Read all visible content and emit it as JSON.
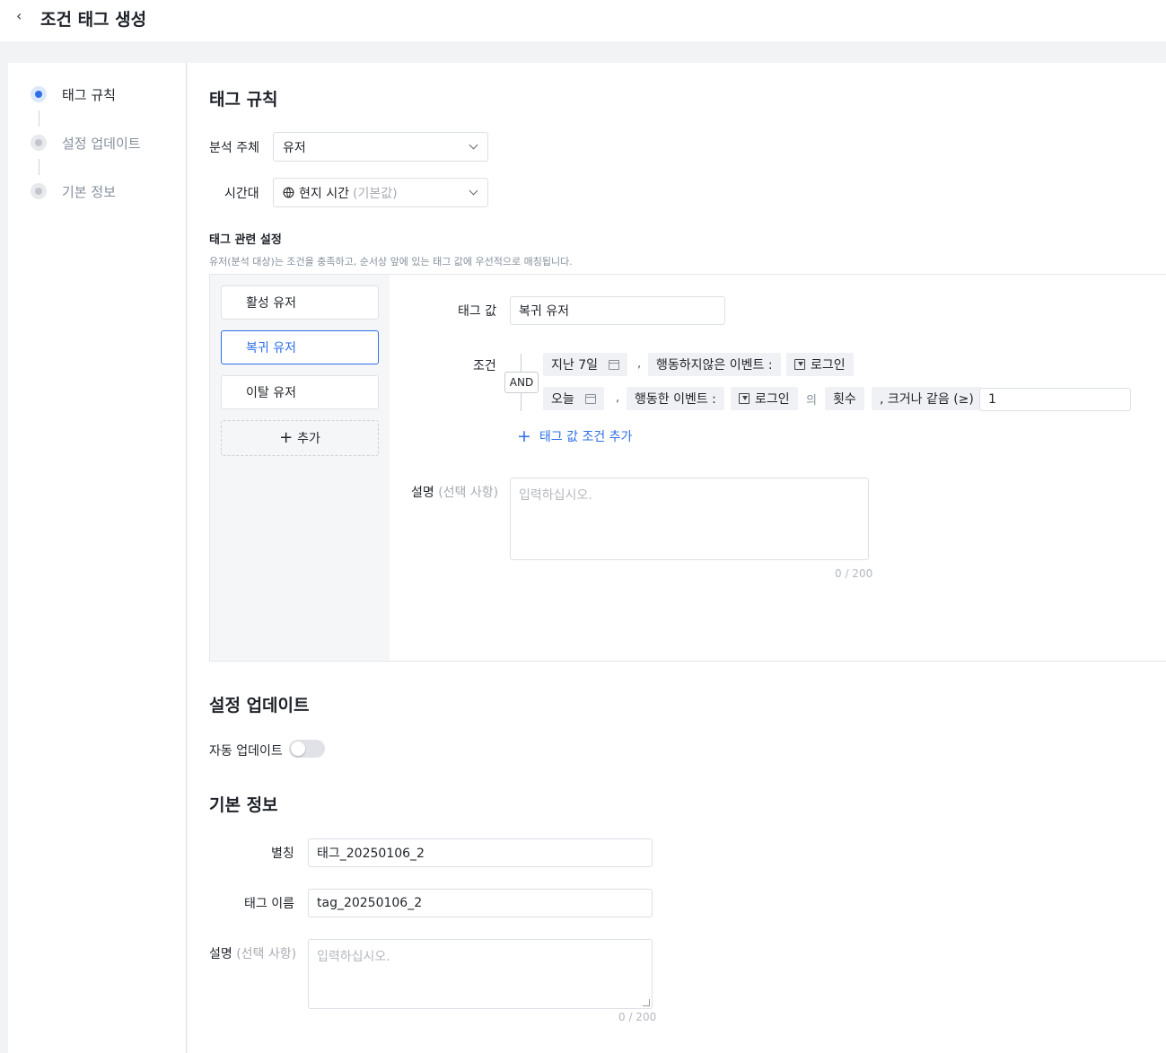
{
  "header": {
    "back_icon": "chevron-left-icon",
    "title": "조건 태그 생성"
  },
  "steps": [
    {
      "label": "태그 규칙",
      "active": true
    },
    {
      "label": "설정 업데이트",
      "active": false
    },
    {
      "label": "기본 정보",
      "active": false
    }
  ],
  "tag_rule": {
    "title": "태그 규칙",
    "subject_label": "분석 주체",
    "subject_value": "유저",
    "timezone_label": "시간대",
    "timezone_value": "현지 시간",
    "timezone_hint": "(기본값)",
    "settings_title": "태그 관련 설정",
    "settings_desc": "유저(분석 대상)는 조건을 충족하고, 순서상 앞에 있는 태그 값에 우선적으로 매칭됩니다.",
    "tag_values": [
      "활성 유저",
      "복귀 유저",
      "이탈 유저"
    ],
    "add_label": "추가",
    "tag_value_label": "태그 값",
    "tag_value_input": "복귀 유저",
    "condition_label": "조건",
    "and_label": "AND",
    "cond1": {
      "date": "지난 7일",
      "comma": ",",
      "event_type": "행동하지않은 이벤트 :",
      "event": "로그인"
    },
    "cond2": {
      "date": "오늘",
      "comma": ",",
      "event_type": "행동한 이벤트 :",
      "event": "로그인",
      "of": "의",
      "metric": "횟수",
      "operator": ", 크거나 같음 (≥)",
      "value": "1"
    },
    "add_condition": "태그 값 조건 추가",
    "desc_label": "설명",
    "desc_optional": "(선택 사항)",
    "desc_placeholder": "입력하십시오.",
    "desc_counter": "0 / 200"
  },
  "update": {
    "title": "설정 업데이트",
    "auto_label": "자동 업데이트",
    "auto_on": false
  },
  "basic": {
    "title": "기본 정보",
    "alias_label": "별칭",
    "alias_value": "태그_20250106_2",
    "name_label": "태그 이름",
    "name_value": "tag_20250106_2",
    "desc_label": "설명",
    "desc_optional": "(선택 사항)",
    "desc_placeholder": "입력하십시오.",
    "desc_counter": "0 / 200"
  },
  "colors": {
    "accent": "#2e6fe8",
    "bg": "#f2f3f5"
  }
}
